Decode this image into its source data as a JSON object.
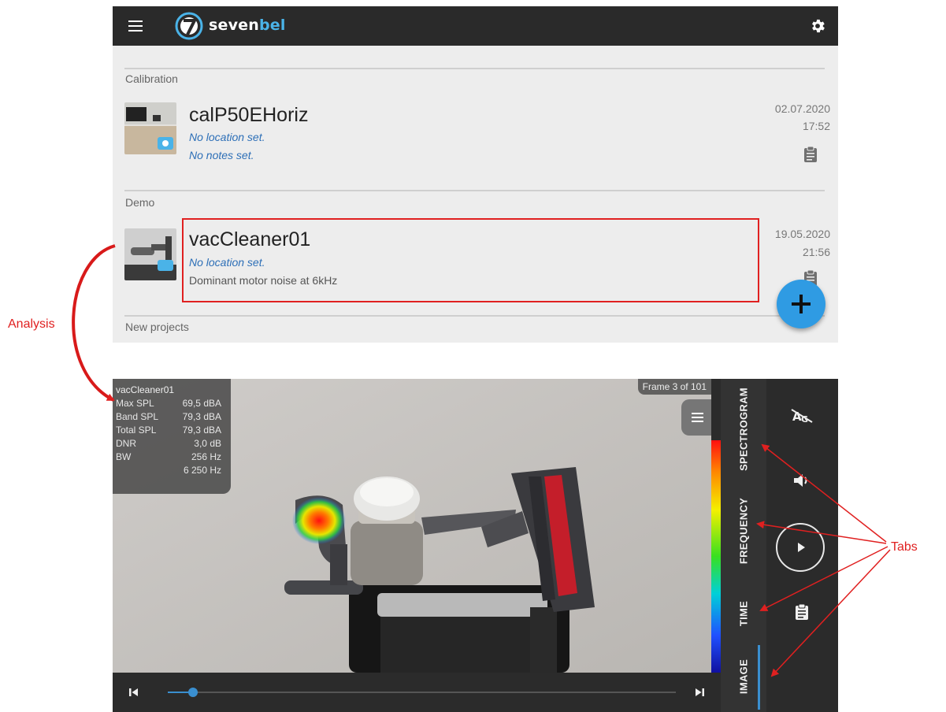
{
  "header": {
    "logo_main": "seven",
    "logo_accent": "bel",
    "icons": [
      "hamburger-menu-icon",
      "logo-icon",
      "gear-icon"
    ]
  },
  "sections": [
    {
      "label": "Calibration"
    },
    {
      "label": "Demo"
    },
    {
      "label": "New projects"
    }
  ],
  "projects": [
    {
      "title": "calP50EHoriz",
      "location": "No location set.",
      "notes": "No notes set.",
      "date": "02.07.2020",
      "time": "17:52"
    },
    {
      "title": "vacCleaner01",
      "location": "No location set.",
      "notes": "Dominant motor noise at 6kHz",
      "date": "19.05.2020",
      "time": "21:56"
    }
  ],
  "fab": {
    "icon": "plus-icon"
  },
  "analysis": {
    "title": "vacCleaner01",
    "rows": [
      {
        "label": "Max SPL",
        "value": "69,5 dBA"
      },
      {
        "label": "Band SPL",
        "value": "79,3 dBA"
      },
      {
        "label": "Total SPL",
        "value": "79,3 dBA"
      },
      {
        "label": "DNR",
        "value": "3,0 dB"
      },
      {
        "label": "BW",
        "value": "256 Hz"
      },
      {
        "label": "",
        "value": "6 250 Hz"
      }
    ],
    "frame": "Frame 3 of 101",
    "progress": 0.05
  },
  "tabs": [
    "SPECTROGRAM",
    "FREQUENCY",
    "TIME",
    "IMAGE"
  ],
  "active_tab": "IMAGE",
  "tool_icons": [
    "a-weighting-off-icon",
    "volume-icon",
    "play-icon",
    "clipboard-icon",
    "skip-start-icon",
    "skip-end-icon"
  ],
  "annotations": {
    "analysis": "Analysis",
    "tabs": "Tabs"
  },
  "colors": {
    "appbar": "#2a2a2a",
    "accent": "#4ab3e8",
    "fab": "#2f9be3",
    "annotation": "#e02020",
    "slider": "#3a8fd0"
  }
}
